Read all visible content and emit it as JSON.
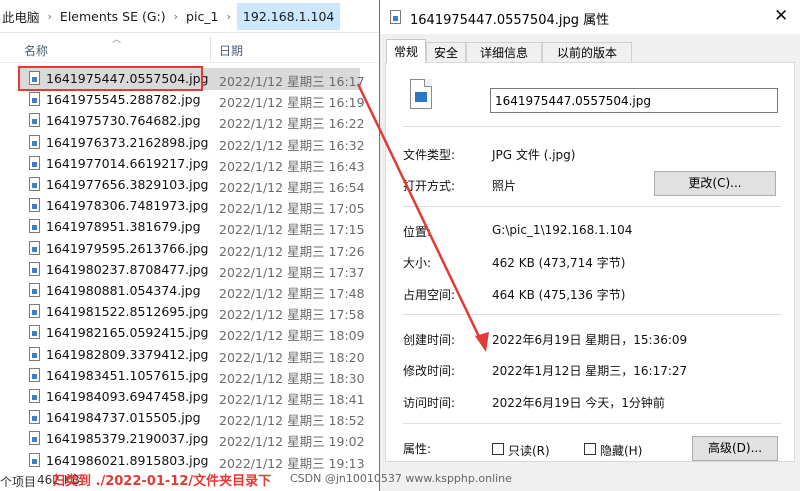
{
  "explorer": {
    "breadcrumb": [
      "此电脑",
      "Elements SE (G:)",
      "pic_1",
      "192.168.1.104"
    ],
    "columns": {
      "name": "名称",
      "date": "日期"
    },
    "files": [
      {
        "name": "1641975447.0557504.jpg",
        "date": "2022/1/12 星期三 16:17",
        "selected": true
      },
      {
        "name": "1641975545.288782.jpg",
        "date": "2022/1/12 星期三 16:19"
      },
      {
        "name": "1641975730.764682.jpg",
        "date": "2022/1/12 星期三 16:22"
      },
      {
        "name": "1641976373.2162898.jpg",
        "date": "2022/1/12 星期三 16:32"
      },
      {
        "name": "1641977014.6619217.jpg",
        "date": "2022/1/12 星期三 16:43"
      },
      {
        "name": "1641977656.3829103.jpg",
        "date": "2022/1/12 星期三 16:54"
      },
      {
        "name": "1641978306.7481973.jpg",
        "date": "2022/1/12 星期三 17:05"
      },
      {
        "name": "1641978951.381679.jpg",
        "date": "2022/1/12 星期三 17:15"
      },
      {
        "name": "1641979595.2613766.jpg",
        "date": "2022/1/12 星期三 17:26"
      },
      {
        "name": "1641980237.8708477.jpg",
        "date": "2022/1/12 星期三 17:37"
      },
      {
        "name": "1641980881.054374.jpg",
        "date": "2022/1/12 星期三 17:48"
      },
      {
        "name": "1641981522.8512695.jpg",
        "date": "2022/1/12 星期三 17:58"
      },
      {
        "name": "1641982165.0592415.jpg",
        "date": "2022/1/12 星期三 18:09"
      },
      {
        "name": "1641982809.3379412.jpg",
        "date": "2022/1/12 星期三 18:20"
      },
      {
        "name": "1641983451.1057615.jpg",
        "date": "2022/1/12 星期三 18:30"
      },
      {
        "name": "1641984093.6947458.jpg",
        "date": "2022/1/12 星期三 18:41"
      },
      {
        "name": "1641984737.015505.jpg",
        "date": "2022/1/12 星期三 18:52"
      },
      {
        "name": "1641985379.2190037.jpg",
        "date": "2022/1/12 星期三 19:02"
      },
      {
        "name": "1641986021.8915803.jpg",
        "date": "2022/1/12 星期三 19:13"
      }
    ],
    "status": {
      "count": "个项目",
      "size": "462 KB"
    }
  },
  "dialog": {
    "title": "1641975447.0557504.jpg 属性",
    "close": "✕",
    "tabs": [
      "常规",
      "安全",
      "详细信息",
      "以前的版本"
    ],
    "filename": "1641975447.0557504.jpg",
    "file_type_label": "文件类型:",
    "file_type_value": "JPG 文件 (.jpg)",
    "open_with_label": "打开方式:",
    "open_with_value": "照片",
    "change_button": "更改(C)...",
    "location_label": "位置:",
    "location_value": "G:\\pic_1\\192.168.1.104",
    "size_label": "大小:",
    "size_value": "462 KB (473,714 字节)",
    "disk_size_label": "占用空间:",
    "disk_size_value": "464 KB (475,136 字节)",
    "created_label": "创建时间:",
    "created_value": "2022年6月19日 星期日，15:36:09",
    "modified_label": "修改时间:",
    "modified_value": "2022年1月12日 星期三，16:17:27",
    "accessed_label": "访问时间:",
    "accessed_value": "2022年6月19日 今天，1分钟前",
    "attributes_label": "属性:",
    "readonly_label": "只读(R)",
    "hidden_label": "隐藏(H)",
    "advanced_button": "高级(D)..."
  },
  "annotation": {
    "note": "归类到 ./2022-01-12/文件夹目录下",
    "color": "#e53935"
  },
  "watermark": "CSDN @jn10010537 www.kspphp.online"
}
